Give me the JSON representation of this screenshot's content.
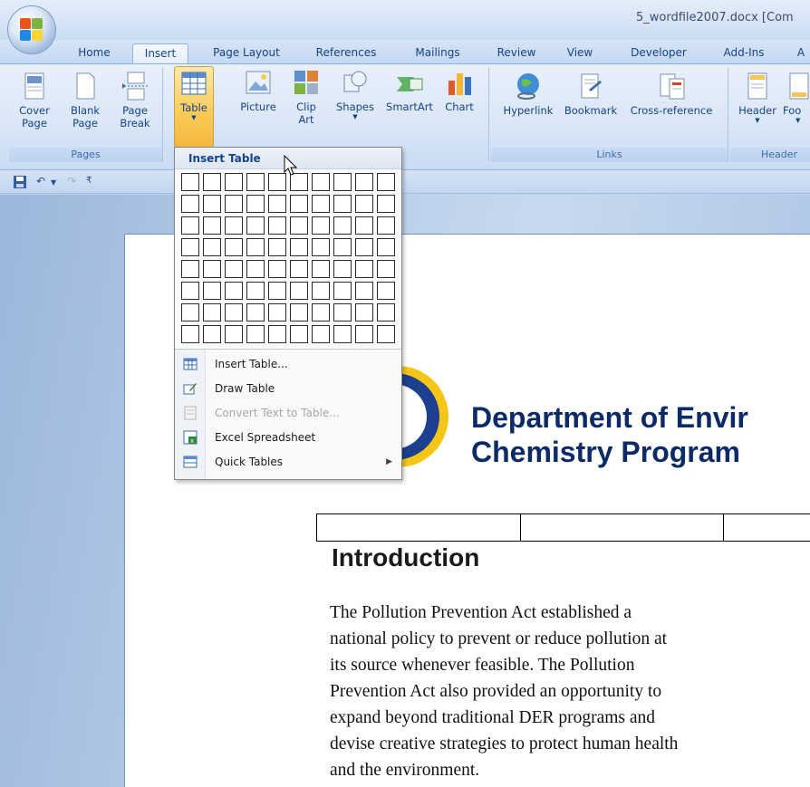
{
  "window": {
    "title": "5_wordfile2007.docx [Com"
  },
  "tabs": [
    {
      "label": "Home"
    },
    {
      "label": "Insert"
    },
    {
      "label": "Page Layout"
    },
    {
      "label": "References"
    },
    {
      "label": "Mailings"
    },
    {
      "label": "Review"
    },
    {
      "label": "View"
    },
    {
      "label": "Developer"
    },
    {
      "label": "Add-Ins"
    },
    {
      "label": "A"
    }
  ],
  "active_tab": "Insert",
  "ribbon": {
    "pages_group": "Pages",
    "cover_page": "Cover\nPage",
    "blank_page": "Blank\nPage",
    "page_break": "Page\nBreak",
    "table": "Table",
    "picture": "Picture",
    "clip_art": "Clip\nArt",
    "shapes": "Shapes",
    "smartart": "SmartArt",
    "chart": "Chart",
    "links_group": "Links",
    "hyperlink": "Hyperlink",
    "bookmark": "Bookmark",
    "cross_reference": "Cross-reference",
    "header_group": "Header",
    "header": "Header",
    "footer": "Foo"
  },
  "table_menu": {
    "heading": "Insert Table",
    "grid_cols": 10,
    "grid_rows": 8,
    "items": [
      {
        "label": "Insert Table...",
        "icon": "insert-table-icon",
        "enabled": true,
        "submenu": false
      },
      {
        "label": "Draw Table",
        "icon": "draw-table-icon",
        "enabled": true,
        "submenu": false
      },
      {
        "label": "Convert Text to Table...",
        "icon": "convert-text-icon",
        "enabled": false,
        "submenu": false
      },
      {
        "label": "Excel Spreadsheet",
        "icon": "excel-spreadsheet-icon",
        "enabled": true,
        "submenu": false
      },
      {
        "label": "Quick Tables",
        "icon": "quick-tables-icon",
        "enabled": true,
        "submenu": true
      }
    ]
  },
  "document": {
    "heading_line1": "Department of Envir",
    "heading_line2": "Chemistry Program",
    "section_title": "Introduction",
    "paragraph": "The Pollution Prevention Act established a\nnational policy to prevent or reduce pollution at\nits source whenever feasible. The Pollution\nPrevention Act also provided an opportunity to\nexpand beyond traditional DER programs and\ndevise creative strategies to protect human health\nand the environment."
  },
  "colors": {
    "ribbon_text": "#15428b",
    "heading": "#0c2a66",
    "accent_orange": "#fbca55"
  }
}
